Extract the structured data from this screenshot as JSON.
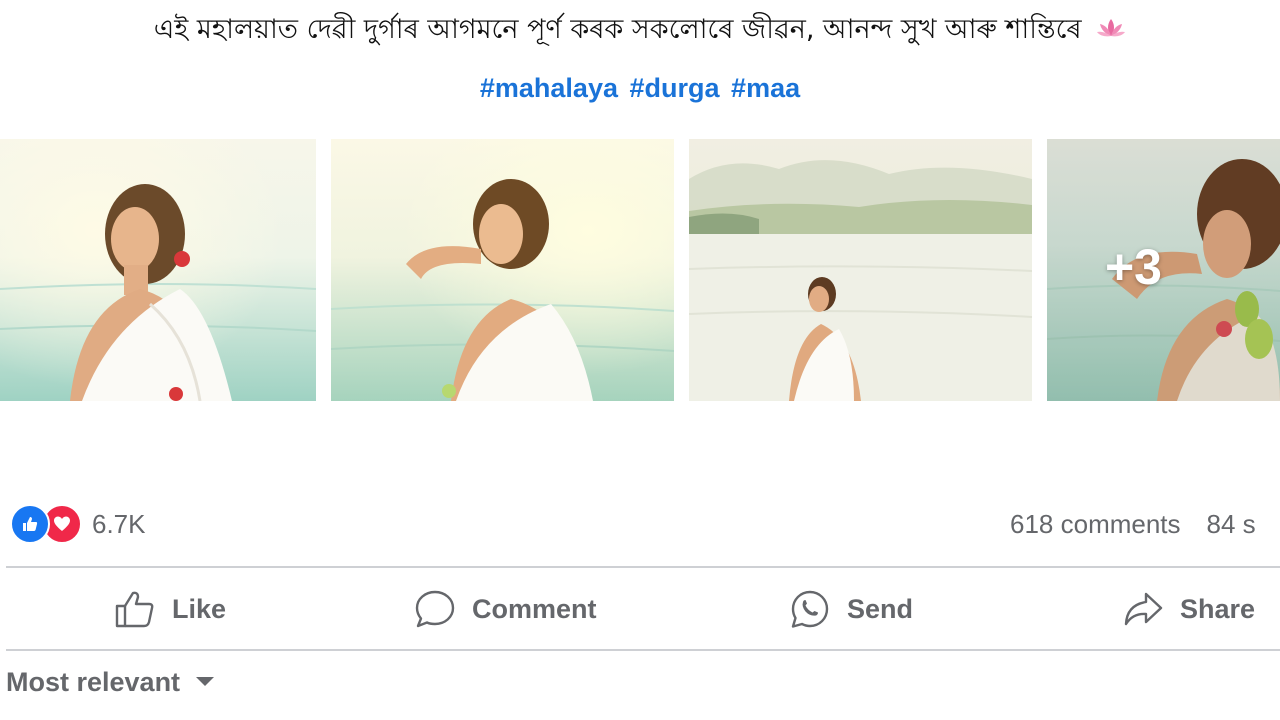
{
  "post": {
    "caption": "এই মহালয়াত দেৱী দুৰ্গাৰ আগমনে পূৰ্ণ কৰক সকলোৰে জীৱন, আনন্দ সুখ আৰু শান্তিৰে",
    "caption_emoji": "lotus-icon",
    "hashtags": [
      "#mahalaya",
      "#durga",
      "#maa"
    ],
    "photos": [
      {
        "name": "photo-1"
      },
      {
        "name": "photo-2"
      },
      {
        "name": "photo-3"
      },
      {
        "name": "photo-4",
        "more_label": "+3"
      }
    ]
  },
  "stats": {
    "reactions_count": "6.7K",
    "reaction_icons": [
      "like-icon",
      "love-icon"
    ],
    "comments": "618 comments",
    "shares": "84 s"
  },
  "actions": {
    "like": "Like",
    "comment": "Comment",
    "send": "Send",
    "share": "Share"
  },
  "comments_sort": {
    "label": "Most relevant"
  },
  "colors": {
    "hashtag": "#1a73d8",
    "like_blue": "#1877f2",
    "love_red": "#f02849",
    "muted_text": "#65676b",
    "divider": "#ced0d4"
  }
}
